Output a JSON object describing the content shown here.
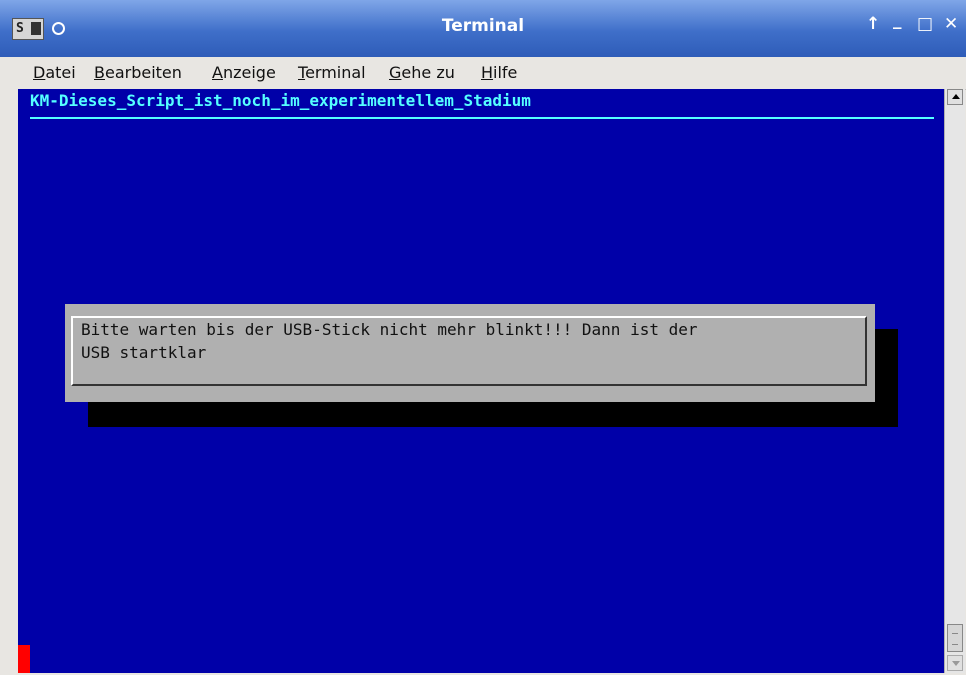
{
  "window": {
    "title": "Terminal",
    "app_icon_label": "S",
    "buttons": {
      "up": "↑",
      "minimize": "_",
      "maximize": "□",
      "close": "✕"
    }
  },
  "menubar": {
    "items": [
      {
        "accel": "D",
        "rest": "atei"
      },
      {
        "accel": "B",
        "rest": "earbeiten"
      },
      {
        "accel": "A",
        "rest": "nzeige"
      },
      {
        "accel": "T",
        "rest": "erminal"
      },
      {
        "accel": "G",
        "rest": "ehe zu"
      },
      {
        "accel": "H",
        "rest": "ilfe"
      }
    ]
  },
  "terminal": {
    "title": "KM-Dieses_Script_ist_noch_im_experimentellem_Stadium",
    "dialog": {
      "line1": "Bitte warten bis der USB-Stick nicht mehr blinkt!!! Dann ist der",
      "line2": "USB startklar"
    }
  },
  "colors": {
    "terminal_bg": "#0000a8",
    "title_fg": "#55ffff",
    "cursor": "#ff0000"
  }
}
